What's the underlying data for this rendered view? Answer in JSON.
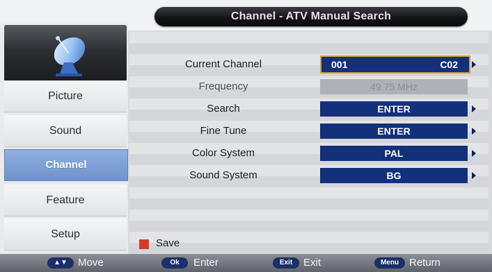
{
  "header": {
    "title": "Channel - ATV Manual Search"
  },
  "sidebar": {
    "icon": "satellite-dish-icon",
    "items": [
      {
        "label": "Picture",
        "active": false
      },
      {
        "label": "Sound",
        "active": false
      },
      {
        "label": "Channel",
        "active": true
      },
      {
        "label": "Feature",
        "active": false
      },
      {
        "label": "Setup",
        "active": false
      }
    ]
  },
  "settings": {
    "current_channel": {
      "label": "Current Channel",
      "number": "001",
      "code": "C02"
    },
    "frequency": {
      "label": "Frequency",
      "value": "49.75 MHz"
    },
    "search": {
      "label": "Search",
      "value": "ENTER"
    },
    "fine_tune": {
      "label": "Fine Tune",
      "value": "ENTER"
    },
    "color_system": {
      "label": "Color System",
      "value": "PAL"
    },
    "sound_system": {
      "label": "Sound System",
      "value": "BG"
    }
  },
  "save": {
    "label": "Save",
    "color": "#d43b2a"
  },
  "footer": {
    "hints": [
      {
        "key": "▲▼",
        "label": "Move"
      },
      {
        "key": "Ok",
        "label": "Enter"
      },
      {
        "key": "Exit",
        "label": "Exit"
      },
      {
        "key": "Menu",
        "label": "Return"
      }
    ]
  },
  "colors": {
    "value_box": "#13307a",
    "active_tab": "#7e9fd6",
    "selected_border": "#c9a13b"
  }
}
